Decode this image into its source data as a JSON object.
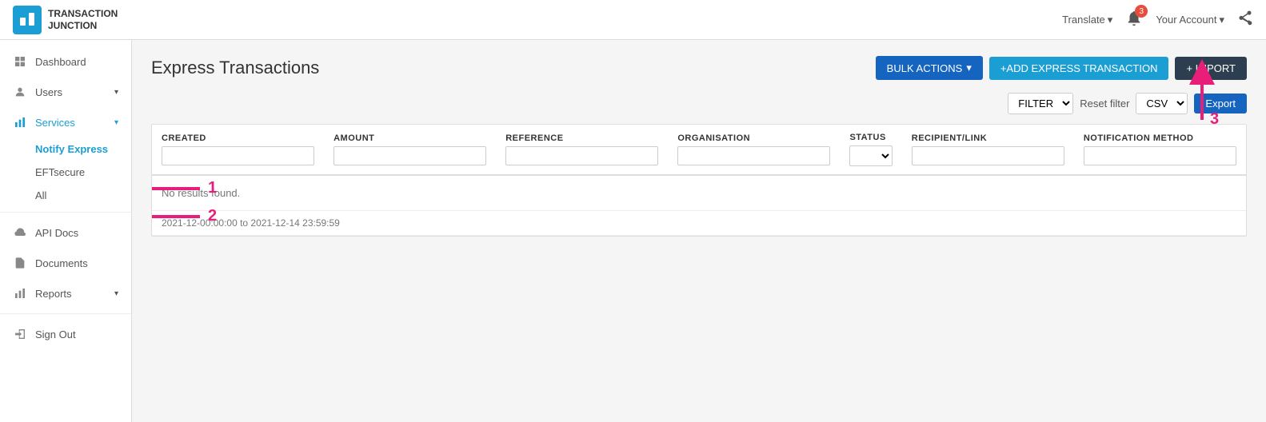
{
  "app": {
    "logo_text_line1": "TRANSACTION",
    "logo_text_line2": "JUNCTION"
  },
  "top_nav": {
    "translate_label": "Translate",
    "notif_count": "3",
    "account_label": "Your Account"
  },
  "sidebar": {
    "items": [
      {
        "id": "dashboard",
        "label": "Dashboard",
        "icon": "chart",
        "has_sub": false
      },
      {
        "id": "users",
        "label": "Users",
        "icon": "user",
        "has_sub": true
      },
      {
        "id": "services",
        "label": "Services",
        "icon": "bar-chart",
        "has_sub": true
      },
      {
        "id": "notify-express",
        "label": "Notify Express",
        "icon": "",
        "has_sub": false,
        "is_sub": true,
        "active": true
      },
      {
        "id": "eftsecure",
        "label": "EFTsecure",
        "icon": "",
        "has_sub": false,
        "is_sub": true
      },
      {
        "id": "all",
        "label": "All",
        "icon": "",
        "has_sub": false,
        "is_sub": true
      },
      {
        "id": "api-docs",
        "label": "API Docs",
        "icon": "cloud",
        "has_sub": false
      },
      {
        "id": "documents",
        "label": "Documents",
        "icon": "doc",
        "has_sub": false
      },
      {
        "id": "reports",
        "label": "Reports",
        "icon": "bar-chart",
        "has_sub": true
      },
      {
        "id": "sign-out",
        "label": "Sign Out",
        "icon": "signout",
        "has_sub": false
      }
    ]
  },
  "page": {
    "title": "Express Transactions",
    "bulk_actions_label": "BULK ACTIONS",
    "add_transaction_label": "+ADD EXPRESS TRANSACTION",
    "import_label": "+ IMPORT",
    "filter_label": "FILTER",
    "reset_filter_label": "Reset filter",
    "csv_label": "CSV",
    "export_label": "Export"
  },
  "table": {
    "columns": [
      {
        "id": "created",
        "label": "CREATED",
        "has_filter_input": true
      },
      {
        "id": "amount",
        "label": "AMOUNT",
        "has_filter_input": true
      },
      {
        "id": "reference",
        "label": "REFERENCE",
        "has_filter_input": true
      },
      {
        "id": "organisation",
        "label": "ORGANISATION",
        "has_filter_input": true
      },
      {
        "id": "status",
        "label": "STATUS",
        "has_filter_select": true
      },
      {
        "id": "recipient",
        "label": "RECIPIENT/LINK",
        "has_filter_input": true
      },
      {
        "id": "notification",
        "label": "NOTIFICATION METHOD",
        "has_filter_input": true
      }
    ],
    "no_results_text": "No results found.",
    "date_range_text": "2021-12-00:00:00 to 2021-12-14 23:59:59"
  }
}
